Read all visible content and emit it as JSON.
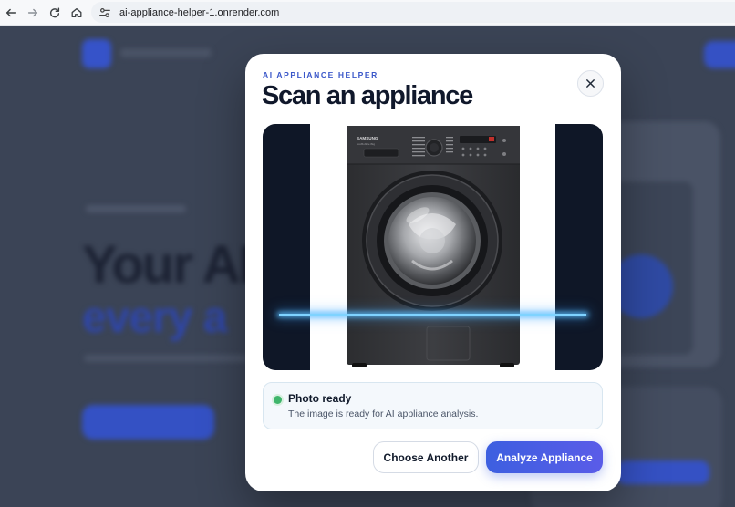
{
  "browser": {
    "url": "ai-appliance-helper-1.onrender.com",
    "icons": [
      "back-icon",
      "forward-icon",
      "reload-icon",
      "home-icon",
      "site-settings-icon"
    ]
  },
  "background_page": {
    "headline_1": "Your AI",
    "headline_2": "every a",
    "accent_color": "#3551c4"
  },
  "modal": {
    "eyebrow": "AI APPLIANCE HELPER",
    "title": "Scan an appliance",
    "close_icon": "close-icon",
    "preview": {
      "subject": "washing machine photo",
      "brand_text": "SAMSUNG",
      "model_text": "EcoBubble   8kg"
    },
    "status": {
      "heading": "Photo ready",
      "message": "The image is ready for AI appliance analysis.",
      "color": "#3fb56b"
    },
    "buttons": {
      "secondary": "Choose Another",
      "primary": "Analyze Appliance"
    },
    "colors": {
      "accent": "#3d5fe0",
      "dark": "#0f1727"
    }
  }
}
